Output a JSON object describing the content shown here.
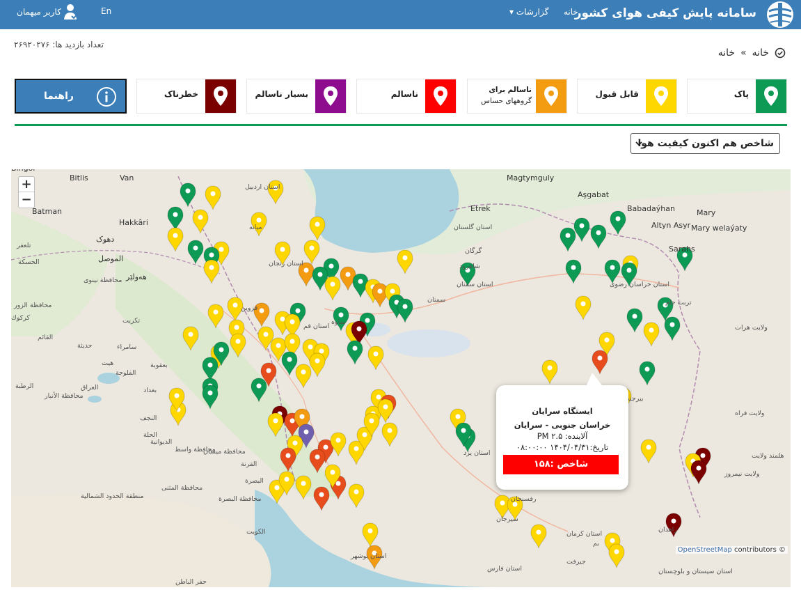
{
  "header": {
    "site_title": "سامانه پایش کیفی هوای کشور",
    "nav_home": "خانه",
    "nav_reports": "گزارشات",
    "nav_lang": "En",
    "user_label": "کاربر میهمان"
  },
  "visits_label": "تعداد بازدید ها: ۲۶۹۲۰۲۷۶",
  "breadcrumb": {
    "home": "خانه",
    "sep": "»",
    "current": "خانه"
  },
  "legend": [
    {
      "label": "پاک",
      "color": "#0d9a54"
    },
    {
      "label": "قابل قبول",
      "color": "#ffd700"
    },
    {
      "label_line1": "ناسالم برای",
      "label_line2": "گروههای حساس",
      "color": "#f39c12"
    },
    {
      "label": "ناسالم",
      "color": "#ff0000"
    },
    {
      "label": "بسیار ناسالم",
      "color": "#8e0c8e"
    },
    {
      "label": "خطرناک",
      "color": "#7a0000"
    }
  ],
  "guide_button": "راهنما",
  "select": {
    "value": "شاخص هم اکنون کیفیت هوا"
  },
  "map": {
    "popup": {
      "title": "ایستگاه سرایان",
      "location": "خراسان جنوبی - سرایان",
      "pollutant": "آلاینده: PM ۲.۵",
      "date": "تاریخ:۱۴۰۴/۰۴/۳۱ ۰۸:۰۰:۰۰",
      "index": "شاخص :۱۵۸",
      "index_color": "#ff0000"
    },
    "attribution_osm": "OpenStreetMap",
    "attribution_rest": "contributors ©",
    "zoom_in": "+",
    "zoom_out": "−",
    "labels": [
      "Bingöl",
      "Bitlis",
      "Van",
      "Batman",
      "Hakkâri",
      "دهوک",
      "الموصل",
      "هەولێر",
      "Etrek",
      "Magtymguly",
      "Aşgabat",
      "Babadaýhan",
      "Altyn Asyr",
      "Mary",
      "Mary welaýaty",
      "Sarahs",
      "استان گلستان",
      "سمنان",
      "استان سمنان",
      "ساوه",
      "استان قم",
      "قزوین",
      "استان زنجان",
      "میانه",
      "استان اردبیل",
      "استان خراسان رضوی",
      "تربت جام",
      "ولایت هرات",
      "ولایت فراه",
      "هلمند ولایت",
      "ولایت نیمروز",
      "زاهدان",
      "استان سیستان و بلوچستان",
      "بیرجند",
      "استان یزد",
      "سیرجان",
      "استان کرمان",
      "جیرفت",
      "بم",
      "استان فارس",
      "استان بوشهر",
      "الكويت",
      "البصرة",
      "محافظة البصرة",
      "محافظة المثنى",
      "منطقة الحدود الشمالية",
      "العراق",
      "بغداد",
      "الفلوجة",
      "الرطبة",
      "هيت",
      "محافظة الأنبار",
      "حفر الباطن",
      "النجف",
      "الحلة",
      "الديوانية",
      "القرنة",
      "محافظة ميسان",
      "محافظة واسط",
      "تكريت",
      "سامراء",
      "القائم",
      "كركوك",
      "حديثة",
      "بعقوبة",
      "تلعفر",
      "الحسكة",
      "محافظة نينوى",
      "محافظة الزور",
      "شاهرود",
      "گرگان",
      "رفسنجان"
    ],
    "pin_colors": {
      "good": "#0d9a54",
      "moderate": "#ffd700",
      "sensitive": "#f39c12",
      "unhealthy": "#e74c1c",
      "very_unhealthy": "#6f5fae",
      "hazardous": "#7a0000"
    }
  }
}
